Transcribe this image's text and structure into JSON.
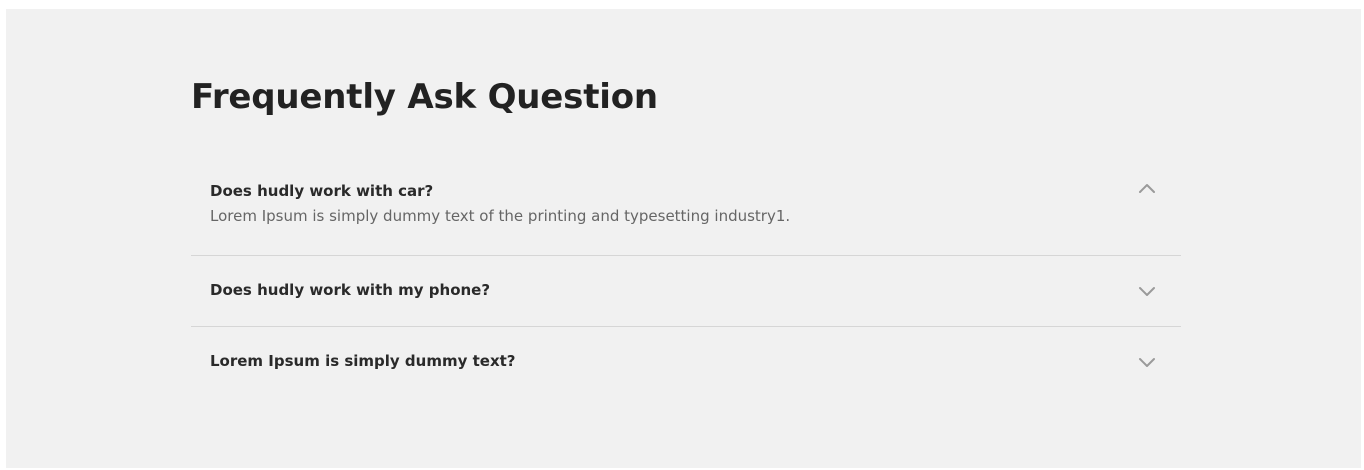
{
  "faq": {
    "title": "Frequently Ask Question",
    "items": [
      {
        "question": "Does hudly work with car?",
        "answer": "Lorem Ipsum is simply dummy text of the printing and typesetting industry1.",
        "expanded": true,
        "icon": "chevron-up-icon"
      },
      {
        "question": "Does hudly work with my phone?",
        "expanded": false,
        "icon": "chevron-down-icon"
      },
      {
        "question": "Lorem Ipsum is simply dummy text?",
        "expanded": false,
        "icon": "chevron-down-icon"
      }
    ]
  },
  "colors": {
    "background": "#f1f1f1",
    "title": "#222222",
    "question": "#2a2a2a",
    "answer": "#666666",
    "divider": "#d6d6d6",
    "chevron": "#9a9a9a"
  }
}
